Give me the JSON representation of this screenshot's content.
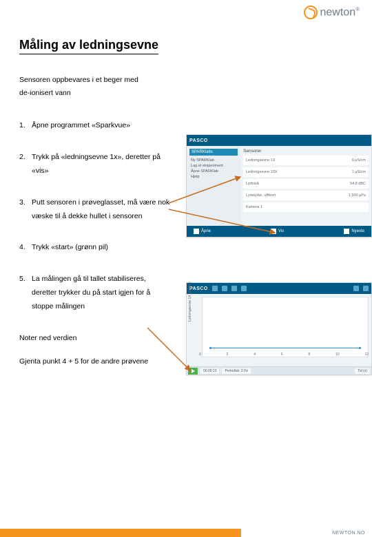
{
  "brand": {
    "name": "newton",
    "reg": "®"
  },
  "title": "Måling av ledningsevne",
  "intro_line1": "Sensoren oppbevares i et beger med",
  "intro_line2": "de-ionisert vann",
  "steps": [
    "Åpne programmet «Sparkvue»",
    "Trykk på «ledningsevne 1x», deretter på «vis»",
    "Putt sensoren i prøveglasset, må være nok væske til å dekke hullet i sensoren",
    "Trykk «start» (grønn pil)",
    "La målingen gå til tallet stabiliseres, deretter trykker du på start igjen for å stoppe målingen"
  ],
  "note1": "Noter ned verdien",
  "note2": "Gjenta punkt 4 + 5 for de andre prøvene",
  "shot1": {
    "brand": "PASCO",
    "side_title": "SPARKlabs",
    "side_items": [
      "Ny SPARKlab",
      "Lag et eksperiment",
      "Åpne SPARKlab",
      "Hjelp"
    ],
    "panel_title": "Sensorer",
    "rows": [
      {
        "l": "Ledningsevne 1X",
        "r": "0 µS/cm"
      },
      {
        "l": "Ledningsevne 10X",
        "r": "1 µS/cm"
      },
      {
        "l": "Lydnivå",
        "r": "54,8 dBC"
      },
      {
        "l": "Lydstyrke, ufiltrert",
        "r": "1,500 µPa"
      },
      {
        "l": "Kamera 1",
        "r": ""
      }
    ],
    "bottom": {
      "open": "Åpne",
      "show": "Vis",
      "new": "Nyeste"
    }
  },
  "shot2": {
    "brand": "PASCO",
    "ylabel": "Ledningsevne 1X (µS/cm)",
    "timer": "00:00:13",
    "rate": "Periodisk: 2 Hz",
    "xticks": [
      "0",
      "2",
      "4",
      "6",
      "8",
      "10",
      "12"
    ],
    "xlabel": "Tid (s)"
  },
  "chart_data": {
    "type": "line",
    "title": "",
    "xlabel": "Tid (s)",
    "ylabel": "Ledningsevne 1X (µS/cm)",
    "x": [
      0,
      2,
      4,
      6,
      8,
      10,
      12
    ],
    "values": [
      0,
      0,
      0,
      0,
      0,
      0,
      0
    ],
    "ylim": [
      0,
      100
    ]
  },
  "footer": "NEWTON.NO"
}
